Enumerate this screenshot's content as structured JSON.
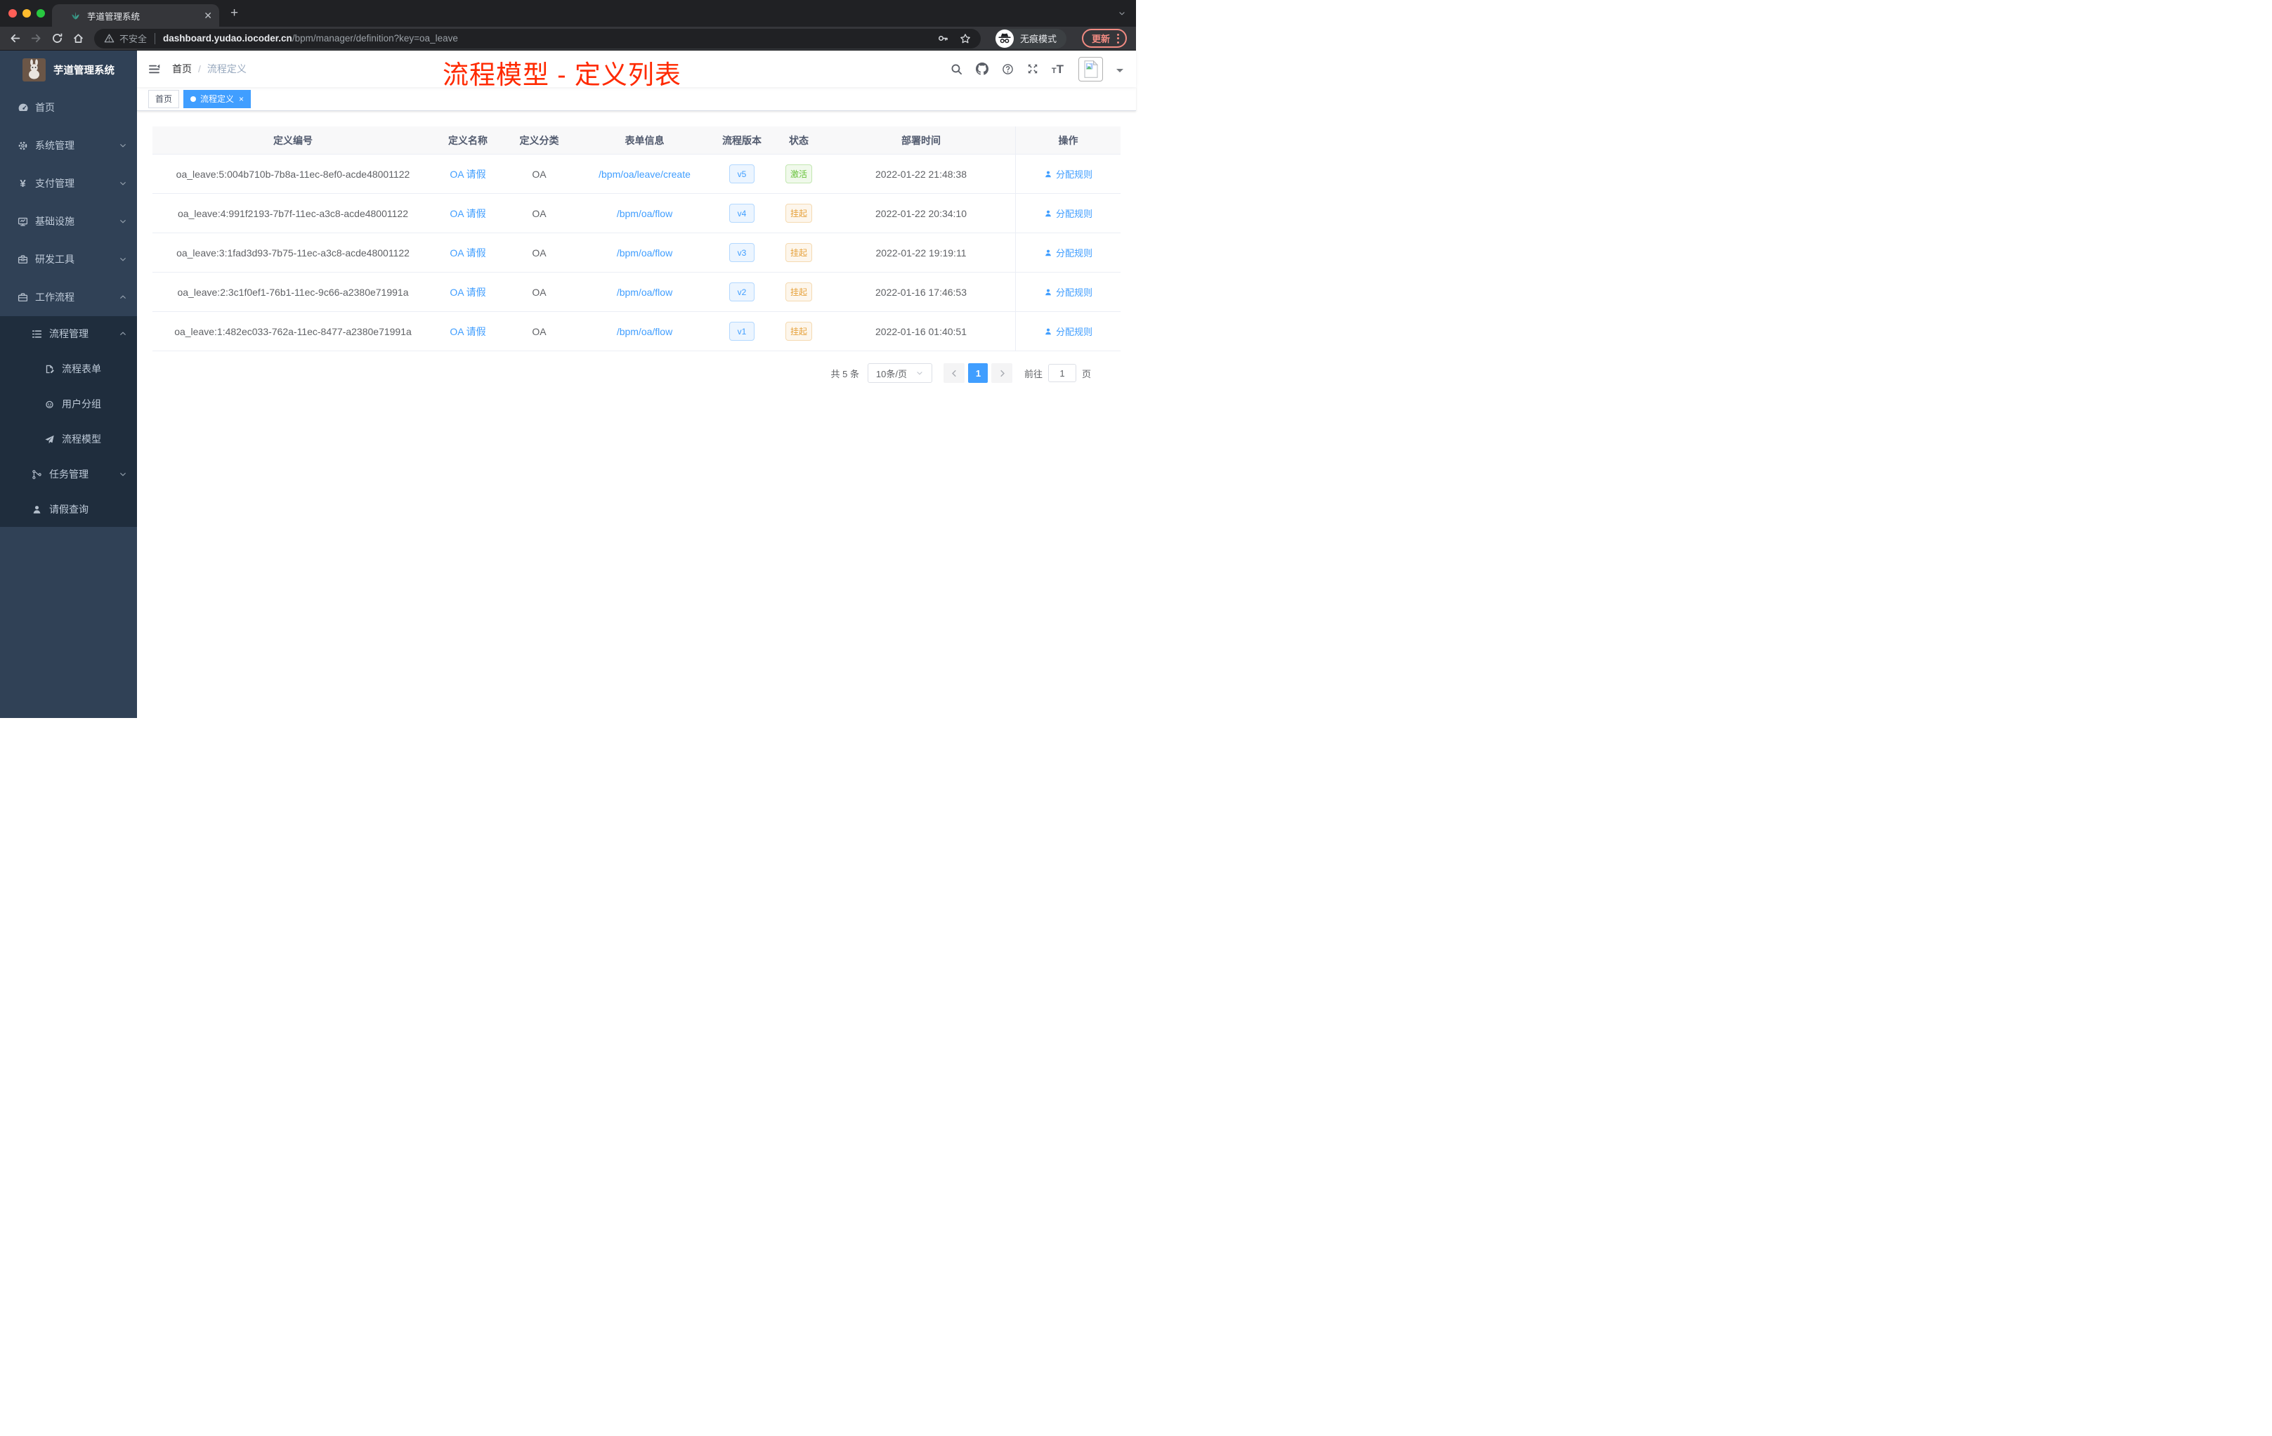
{
  "colors": {
    "primary": "#409EFF",
    "sidebar-bg": "#304156",
    "submenu-bg": "#1f2d3d",
    "annotation": "#FF2A00",
    "success-text": "#67C23A",
    "warning-text": "#E6A23C",
    "update-accent": "#F28B82"
  },
  "browser": {
    "tab_title": "芋道管理系统",
    "security_label": "不安全",
    "url_host": "dashboard.yudao.iocoder.cn",
    "url_path": "/bpm/manager/definition?key=oa_leave",
    "incognito_label": "无痕模式",
    "update_label": "更新"
  },
  "sidebar": {
    "logo_title": "芋道管理系统",
    "items": [
      {
        "label": "首页",
        "icon": "dashboard-icon",
        "chevron": null
      },
      {
        "label": "系统管理",
        "icon": "gear-icon",
        "chevron": "down"
      },
      {
        "label": "支付管理",
        "icon": "yen-icon",
        "chevron": "down"
      },
      {
        "label": "基础设施",
        "icon": "monitor-icon",
        "chevron": "down"
      },
      {
        "label": "研发工具",
        "icon": "toolbox-icon",
        "chevron": "down"
      },
      {
        "label": "工作流程",
        "icon": "briefcase-icon",
        "chevron": "up"
      }
    ],
    "submenu_items": [
      {
        "label": "流程管理",
        "icon": "list-icon",
        "level": 1,
        "chevron": "up"
      },
      {
        "label": "流程表单",
        "icon": "form-icon",
        "level": 2,
        "chevron": null
      },
      {
        "label": "用户分组",
        "icon": "robot-icon",
        "level": 2,
        "chevron": null
      },
      {
        "label": "流程模型",
        "icon": "paper-plane-icon",
        "level": 2,
        "chevron": null
      },
      {
        "label": "任务管理",
        "icon": "tree-icon",
        "level": 1,
        "chevron": "down"
      },
      {
        "label": "请假查询",
        "icon": "user-icon",
        "level": 1,
        "chevron": null
      }
    ]
  },
  "navbar": {
    "breadcrumb": [
      "首页",
      "流程定义"
    ]
  },
  "annotation": "流程模型 - 定义列表",
  "tags": [
    {
      "label": "首页",
      "active": false,
      "closable": false
    },
    {
      "label": "流程定义",
      "active": true,
      "closable": true
    }
  ],
  "table": {
    "columns": [
      "定义编号",
      "定义名称",
      "定义分类",
      "表单信息",
      "流程版本",
      "状态",
      "部署时间",
      "操作"
    ],
    "action_label": "分配规则",
    "rows": [
      {
        "id": "oa_leave:5:004b710b-7b8a-11ec-8ef0-acde48001122",
        "name": "OA 请假",
        "category": "OA",
        "form": "/bpm/oa/leave/create",
        "version": "v5",
        "status": "激活",
        "status_type": "success",
        "deployed_at": "2022-01-22 21:48:38"
      },
      {
        "id": "oa_leave:4:991f2193-7b7f-11ec-a3c8-acde48001122",
        "name": "OA 请假",
        "category": "OA",
        "form": "/bpm/oa/flow",
        "version": "v4",
        "status": "挂起",
        "status_type": "warning",
        "deployed_at": "2022-01-22 20:34:10"
      },
      {
        "id": "oa_leave:3:1fad3d93-7b75-11ec-a3c8-acde48001122",
        "name": "OA 请假",
        "category": "OA",
        "form": "/bpm/oa/flow",
        "version": "v3",
        "status": "挂起",
        "status_type": "warning",
        "deployed_at": "2022-01-22 19:19:11"
      },
      {
        "id": "oa_leave:2:3c1f0ef1-76b1-11ec-9c66-a2380e71991a",
        "name": "OA 请假",
        "category": "OA",
        "form": "/bpm/oa/flow",
        "version": "v2",
        "status": "挂起",
        "status_type": "warning",
        "deployed_at": "2022-01-16 17:46:53"
      },
      {
        "id": "oa_leave:1:482ec033-762a-11ec-8477-a2380e71991a",
        "name": "OA 请假",
        "category": "OA",
        "form": "/bpm/oa/flow",
        "version": "v1",
        "status": "挂起",
        "status_type": "warning",
        "deployed_at": "2022-01-16 01:40:51"
      }
    ]
  },
  "pagination": {
    "total": "共 5 条",
    "page_size": "10条/页",
    "current_page": "1",
    "goto_label": "前往",
    "goto_value": "1",
    "unit_label": "页"
  }
}
